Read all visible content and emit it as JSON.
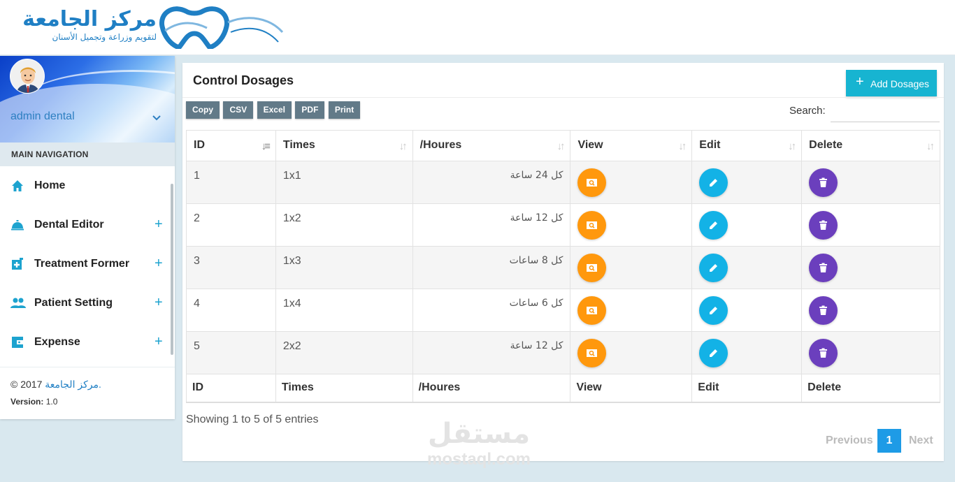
{
  "header": {
    "logo_title": "مركز الجامعة",
    "logo_subtitle": "لتقويم وزراعة وتجميل الأسنان"
  },
  "sidebar": {
    "user_name": "admin dental",
    "nav_header": "MAIN NAVIGATION",
    "items": [
      {
        "label": "Home",
        "icon": "home-icon",
        "expandable": false
      },
      {
        "label": "Dental Editor",
        "icon": "room-service-icon",
        "expandable": true,
        "plus": "+"
      },
      {
        "label": "Treatment Former",
        "icon": "prescription-icon",
        "expandable": true,
        "plus": "+"
      },
      {
        "label": "Patient Setting",
        "icon": "people-icon",
        "expandable": true,
        "plus": "+"
      },
      {
        "label": "Expense",
        "icon": "wallet-icon",
        "expandable": true,
        "plus": "+"
      }
    ],
    "footer": {
      "copyright": "© 2017",
      "brand": "مركز الجامعة.",
      "version_label": "Version:",
      "version_value": "1.0"
    }
  },
  "panel": {
    "title": "Control Dosages",
    "add_button": "Add Dosages",
    "export_buttons": [
      "Copy",
      "CSV",
      "Excel",
      "PDF",
      "Print"
    ],
    "search_label": "Search:",
    "search_value": "",
    "columns": [
      "ID",
      "Times",
      "/Houres",
      "View",
      "Edit",
      "Delete"
    ],
    "rows": [
      {
        "id": "1",
        "times": "1x1",
        "hours": "كل 24 ساعة"
      },
      {
        "id": "2",
        "times": "1x2",
        "hours": "كل 12 ساعة"
      },
      {
        "id": "3",
        "times": "1x3",
        "hours": "كل 8 ساعات"
      },
      {
        "id": "4",
        "times": "1x4",
        "hours": "كل 6 ساعات"
      },
      {
        "id": "5",
        "times": "2x2",
        "hours": "كل 12 ساعة"
      }
    ],
    "info": "Showing 1 to 5 of 5 entries",
    "pagination": {
      "previous": "Previous",
      "current": "1",
      "next": "Next"
    }
  },
  "watermark": {
    "arabic": "مستقل",
    "latin": "mostaql.com"
  },
  "colors": {
    "accent": "#17b4d1",
    "view": "#ff980d",
    "edit": "#13b2e6",
    "delete": "#6b3fbd",
    "export_button": "#627a88",
    "page_active": "#1e9be6"
  }
}
